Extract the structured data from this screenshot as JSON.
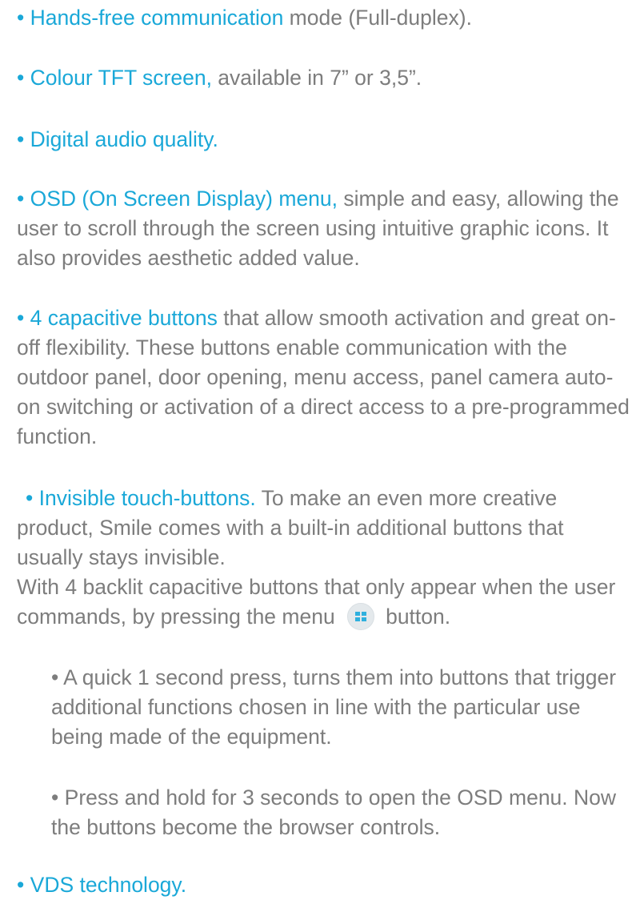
{
  "features": [
    {
      "highlight": "Hands-free communication",
      "text": " mode (Full-duplex)."
    },
    {
      "highlight": "Colour TFT screen,",
      "text": " available in 7” or 3,5”."
    },
    {
      "highlight": "Digital audio quality.",
      "text": ""
    },
    {
      "highlight": "OSD (On Screen Display) menu,",
      "text": " simple and easy, allowing the user to scroll through the screen using intuitive graphic icons. It also provides aesthetic added value."
    },
    {
      "highlight": "4 capacitive buttons",
      "text": " that allow smooth activation and great on-off flexibility.  These buttons enable communication with the outdoor panel, door opening, menu access, panel camera auto-on switching or activation of a direct access to a pre-programmed function."
    },
    {
      "highlight": "Invisible touch-buttons.",
      "text": " To make an even more creative product, Smile comes with a built-in additional buttons that usually stays invisible.",
      "text2": "With 4 backlit capacitive buttons that only appear when the user commands, by pressing the menu",
      "text3": "button."
    },
    {
      "highlight": "VDS technology.",
      "text": ""
    }
  ],
  "sub_items": [
    "• A quick 1 second press, turns them into buttons that trigger additional functions chosen in line with the particular use being made of the equipment.",
    "• Press and hold for 3 seconds to open the OSD menu. Now the buttons become the browser controls."
  ],
  "bullet": "• ",
  "icons": {
    "menu": "menu-grid-icon"
  },
  "colors": {
    "highlight": "#1aa8d8",
    "body_text": "#7d7d7d",
    "icon_bg": "#e4e9ec"
  }
}
